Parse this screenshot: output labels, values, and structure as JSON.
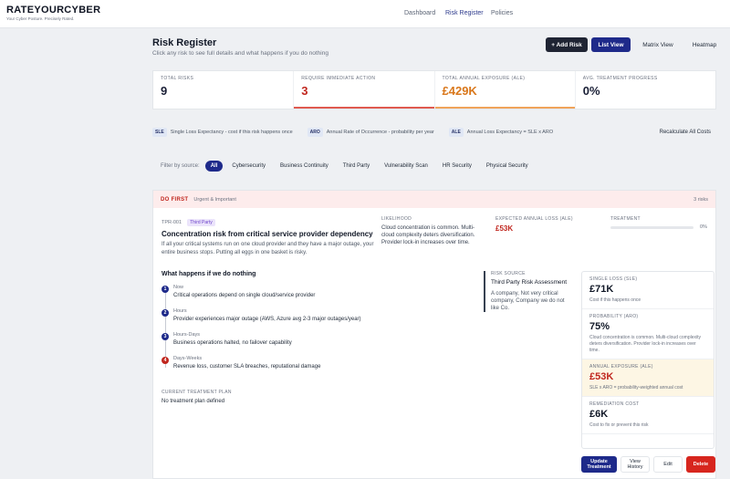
{
  "brand": {
    "name": "RATEYOURCYBER",
    "tagline": "Your Cyber Posture. Precisely Rated."
  },
  "nav": [
    {
      "label": "Dashboard",
      "active": false
    },
    {
      "label": "Risk Register",
      "active": true
    },
    {
      "label": "Policies",
      "active": false
    }
  ],
  "page": {
    "title": "Risk Register",
    "subtitle": "Click any risk to see full details and what happens if you do nothing"
  },
  "toolbar": {
    "add_risk": "+ Add Risk",
    "list_view": "List View",
    "matrix_view": "Matrix View",
    "heatmap": "Heatmap"
  },
  "stats": [
    {
      "label": "Total Risks",
      "value": "9"
    },
    {
      "label": "Require Immediate Action",
      "value": "3"
    },
    {
      "label": "Total Annual Exposure (ALE)",
      "value": "£429K"
    },
    {
      "label": "Avg. Treatment Progress",
      "value": "0%"
    }
  ],
  "legend": {
    "sle_tag": "SLE",
    "sle_text": "Single Loss Expectancy - cost if this risk happens once",
    "aro_tag": "ARO",
    "aro_text": "Annual Rate of Occurrence - probability per year",
    "ale_tag": "ALE",
    "ale_text": "Annual Loss Expectancy = SLE x ARO",
    "recalc": "Recalculate All Costs"
  },
  "filter": {
    "label": "Filter by source:",
    "chips": [
      "All",
      "Cybersecurity",
      "Business Continuity",
      "Third Party",
      "Vulnerability Scan",
      "HR Security",
      "Physical Security"
    ]
  },
  "group": {
    "title": "DO FIRST",
    "subtitle": "Urgent & Important",
    "count": "3 risks"
  },
  "risk": {
    "id": "TPR-001",
    "source_tag": "Third Party",
    "title": "Concentration risk from critical service provider dependency",
    "description": "If all your critical systems run on one cloud provider and they have a major outage, your entire business stops. Putting all eggs in one basket is risky.",
    "likelihood_label": "Likelihood",
    "likelihood_text": "Cloud concentration is common. Multi-cloud complexity deters diversification. Provider lock-in increases over time.",
    "ale_label": "Expected Annual Loss (ALE)",
    "ale_value": "£53K",
    "treatment_label": "Treatment",
    "treatment_pct": "0%",
    "treatment_progress": 0
  },
  "do_nothing": {
    "title": "What happens if we do nothing",
    "steps": [
      {
        "n": "1",
        "when": "Now",
        "text": "Critical operations depend on single cloud/service provider"
      },
      {
        "n": "2",
        "when": "Hours",
        "text": "Provider experiences major outage (AWS, Azure avg 2-3 major outages/year)"
      },
      {
        "n": "3",
        "when": "Hours-Days",
        "text": "Business operations halted, no failover capability"
      },
      {
        "n": "4",
        "when": "Days-Weeks",
        "text": "Revenue loss, customer SLA breaches, reputational damage"
      }
    ]
  },
  "treatment_plan": {
    "label": "Current Treatment Plan",
    "text": "No treatment plan defined"
  },
  "source": {
    "label": "Risk Source",
    "title": "Third Party Risk Assessment",
    "text": "A company, Not very critical company, Company we do not like Co."
  },
  "metrics": [
    {
      "label": "Single Loss (SLE)",
      "value": "£71K",
      "sub": "Cost if this happens once"
    },
    {
      "label": "Probability (ARO)",
      "value": "75%",
      "sub": "Cloud concentration is common. Multi-cloud complexity deters diversification. Provider lock-in increases over time."
    },
    {
      "label": "Annual Exposure (ALE)",
      "value": "£53K",
      "sub": "SLE x ARO = probability-weighted annual cost"
    },
    {
      "label": "Remediation Cost",
      "value": "£6K",
      "sub": "Cost to fix or prevent this risk"
    }
  ],
  "actions": {
    "update": "Update Treatment",
    "history": "View History",
    "edit": "Edit",
    "delete": "Delete"
  },
  "colors": {
    "navy": "#1e2a8a",
    "danger": "#c0261e",
    "exposure": "#d9771b"
  }
}
